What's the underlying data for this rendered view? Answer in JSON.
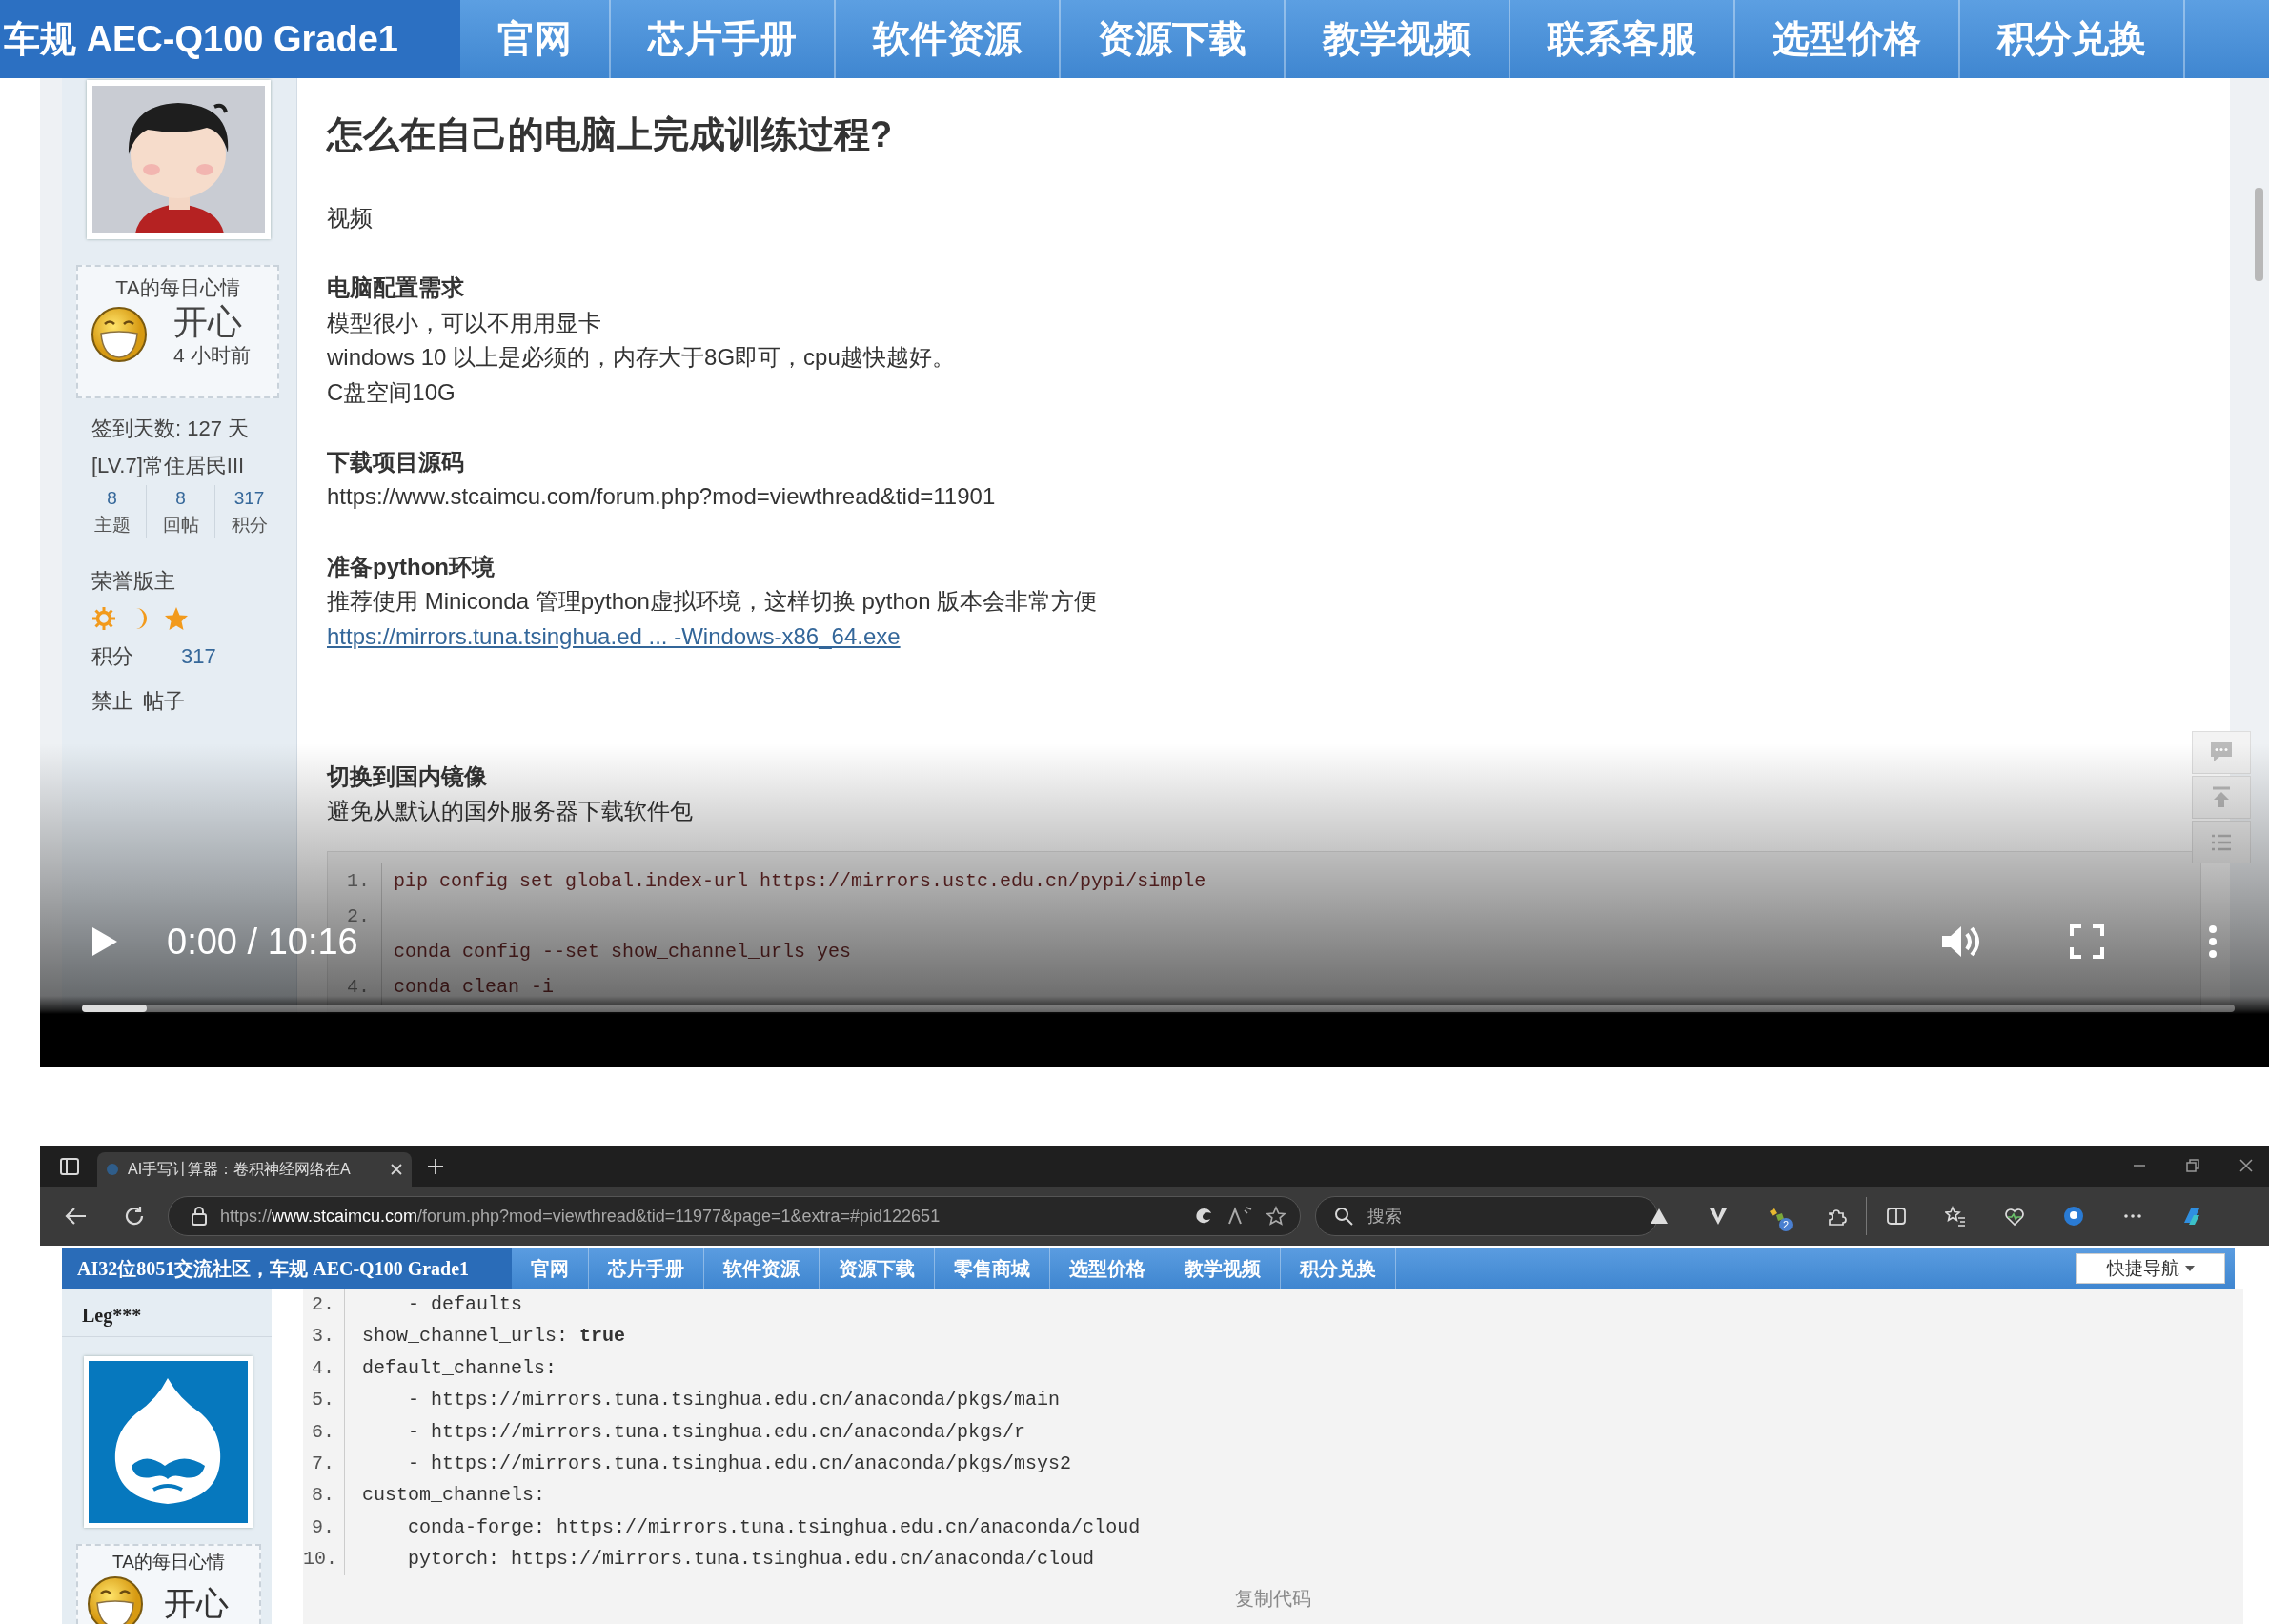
{
  "recording": {
    "site_nav": {
      "brand": "车规 AEC-Q100 Grade1",
      "items": [
        "官网",
        "芯片手册",
        "软件资源",
        "资源下载",
        "教学视频",
        "联系客服",
        "选型价格",
        "积分兑换"
      ]
    },
    "author": {
      "mood_title": "TA的每日心情",
      "mood": "开心",
      "mood_time": "4 小时前",
      "checkin": "签到天数: 127 天",
      "rank": "[LV.7]常住居民III",
      "stats": [
        {
          "value": "8",
          "label": "主题"
        },
        {
          "value": "8",
          "label": "回帖"
        },
        {
          "value": "317",
          "label": "积分"
        }
      ],
      "group": "荣誉版主",
      "medals": [
        {
          "kind": "sun"
        },
        {
          "kind": "moon"
        },
        {
          "kind": "star"
        }
      ],
      "points_label": "积分",
      "points": "317",
      "actions": [
        "禁止",
        "帖子"
      ]
    },
    "post": {
      "title": "怎么在自己的电脑上完成训练过程?",
      "sections": [
        {
          "lines": [
            "视频"
          ]
        },
        {
          "heading": "电脑配置需求",
          "lines": [
            "模型很小，可以不用用显卡",
            "windows 10 以上是必须的，内存大于8G即可，cpu越快越好。",
            "C盘空间10G"
          ]
        },
        {
          "heading": "下载项目源码",
          "lines": [
            "https://www.stcaimcu.com/forum.php?mod=viewthread&tid=11901"
          ]
        },
        {
          "heading": "准备python环境",
          "lines": [
            "推荐使用 Miniconda 管理python虚拟环境，这样切换 python 版本会非常方便"
          ],
          "link": "https://mirrors.tuna.tsinghua.ed ... -Windows-x86_64.exe"
        },
        {
          "heading": "切换到国内镜像",
          "lines": [
            "避免从默认的国外服务器下载软件包"
          ]
        }
      ]
    },
    "code": [
      {
        "number": "1.",
        "code": "pip config set global.index-url https://mirrors.ustc.edu.cn/pypi/simple"
      },
      {
        "number": "2."
      },
      {
        "code": "conda config --set show_channel_urls yes"
      },
      {
        "number": "4.",
        "code": "conda clean -i"
      }
    ],
    "player": {
      "playing": false,
      "time": "0:00 / 10:16",
      "level": 0.03
    }
  },
  "browser": {
    "tab": {
      "title": "AI手写计算器：卷积神经网络在A"
    },
    "address": {
      "scheme": "https://",
      "host": "www.stcaimcu.com",
      "path": "/forum.php?mod=viewthread&tid=11977&page=1&extra=#pid122651"
    },
    "search": {
      "placeholder": "搜索"
    },
    "extension_badge": "2",
    "site_nav": {
      "brand": "AI32位8051交流社区，车规 AEC-Q100 Grade1",
      "items": [
        "官网",
        "芯片手册",
        "软件资源",
        "资源下载",
        "零售商城",
        "选型价格",
        "教学视频",
        "积分兑换"
      ],
      "quick_nav": "快捷导航"
    },
    "author": {
      "name": "Leg***",
      "mood_title": "TA的每日心情",
      "mood": "开心"
    },
    "code": [
      {
        "number": "2.",
        "code": "    - defaults"
      },
      {
        "number": "3.",
        "code": "show_channel_urls: **true**"
      },
      {
        "number": "4.",
        "code": "default_channels:"
      },
      {
        "number": "5.",
        "code": "    - https://mirrors.tuna.tsinghua.edu.cn/anaconda/pkgs/main"
      },
      {
        "number": "6.",
        "code": "    - https://mirrors.tuna.tsinghua.edu.cn/anaconda/pkgs/r"
      },
      {
        "number": "7.",
        "code": "    - https://mirrors.tuna.tsinghua.edu.cn/anaconda/pkgs/msys2"
      },
      {
        "number": "8.",
        "code": "custom_channels:"
      },
      {
        "number": "9.",
        "code": "    conda-forge: https://mirrors.tuna.tsinghua.edu.cn/anaconda/cloud"
      },
      {
        "number": "10.",
        "code": "    pytorch: https://mirrors.tuna.tsinghua.edu.cn/anaconda/cloud"
      }
    ],
    "copy": "复制代码"
  }
}
